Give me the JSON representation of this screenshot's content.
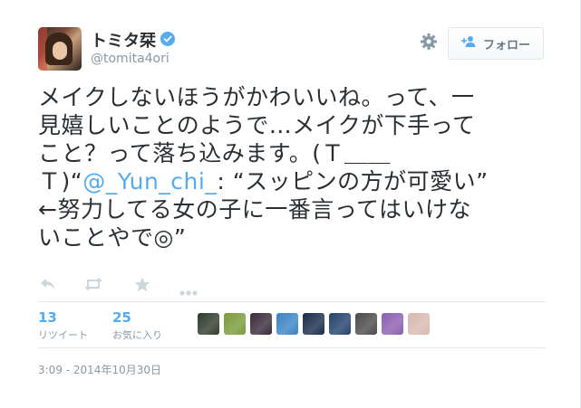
{
  "author": {
    "name": "トミタ栞",
    "handle": "@tomita4ori",
    "verified": true
  },
  "follow_button": {
    "label": "フォロー"
  },
  "tweet": {
    "text_before_mention": "メイクしないほうがかわいいね。って、一\n見嬉しいことのようで…メイクが下手って\nこと？って落ち込みます。(Ｔ＿＿\nＴ)“",
    "mention": "@_Yun_chi_",
    "text_after_mention": ": “スッピンの方が可愛い”\n←努力してる女の子に一番言ってはいけな\nいことやで◎”"
  },
  "actions": {
    "reply_icon": "reply-icon",
    "retweet_icon": "retweet-icon",
    "favorite_icon": "star-icon",
    "more_icon": "more-icon"
  },
  "stats": {
    "retweets": {
      "count": "13",
      "label": "リツイート"
    },
    "favorites": {
      "count": "25",
      "label": "お気に入り"
    }
  },
  "favoriters": [
    {
      "color": "#2f3b2a"
    },
    {
      "color": "#7a9a3a"
    },
    {
      "color": "#3a2a3a"
    },
    {
      "color": "#3a82c4"
    },
    {
      "color": "#1a2a4a"
    },
    {
      "color": "#22416a"
    },
    {
      "color": "#4a4a4a"
    },
    {
      "color": "#8a5fb0"
    },
    {
      "color": "#d8b8b0"
    }
  ],
  "timestamp": "3:09 - 2014年10月30日",
  "colors": {
    "accent": "#55acee",
    "text": "#292f33",
    "muted": "#8899a6",
    "border": "#e1e8ed"
  }
}
